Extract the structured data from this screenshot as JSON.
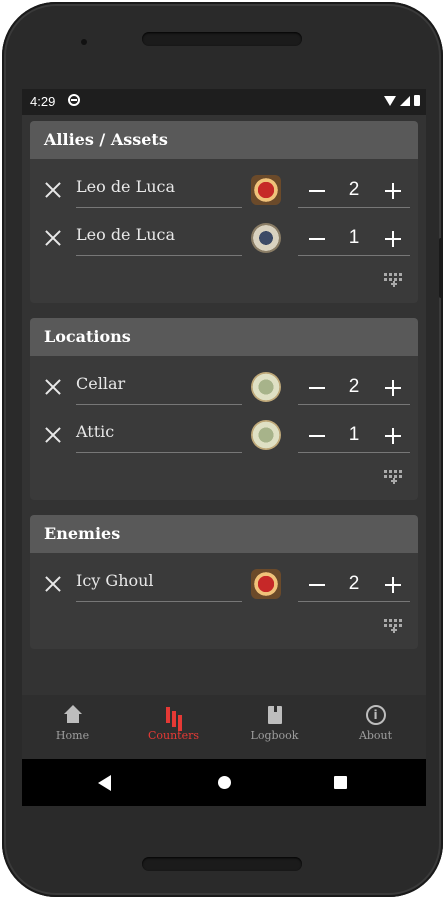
{
  "status_bar": {
    "time": "4:29"
  },
  "sections": [
    {
      "title": "Allies / Assets",
      "rows": [
        {
          "name": "Leo de Luca",
          "token_icon": "wound-token-icon",
          "count": "2"
        },
        {
          "name": "Leo de Luca",
          "token_icon": "horror-token-icon",
          "count": "1"
        }
      ]
    },
    {
      "title": "Locations",
      "rows": [
        {
          "name": "Cellar",
          "token_icon": "clue-token-icon",
          "count": "2"
        },
        {
          "name": "Attic",
          "token_icon": "clue-token-icon",
          "count": "1"
        }
      ]
    },
    {
      "title": "Enemies",
      "rows": [
        {
          "name": "Icy Ghoul",
          "token_icon": "wound-token-icon",
          "count": "2"
        }
      ]
    }
  ],
  "bottom_nav": [
    {
      "label": "Home",
      "icon": "home-icon",
      "active": false
    },
    {
      "label": "Counters",
      "icon": "bar-chart-icon",
      "active": true
    },
    {
      "label": "Logbook",
      "icon": "book-icon",
      "active": false
    },
    {
      "label": "About",
      "icon": "info-icon",
      "active": false
    }
  ],
  "colors": {
    "accent": "#e53935",
    "header_bg": "#595959",
    "card_bg": "#3a3a3a"
  }
}
